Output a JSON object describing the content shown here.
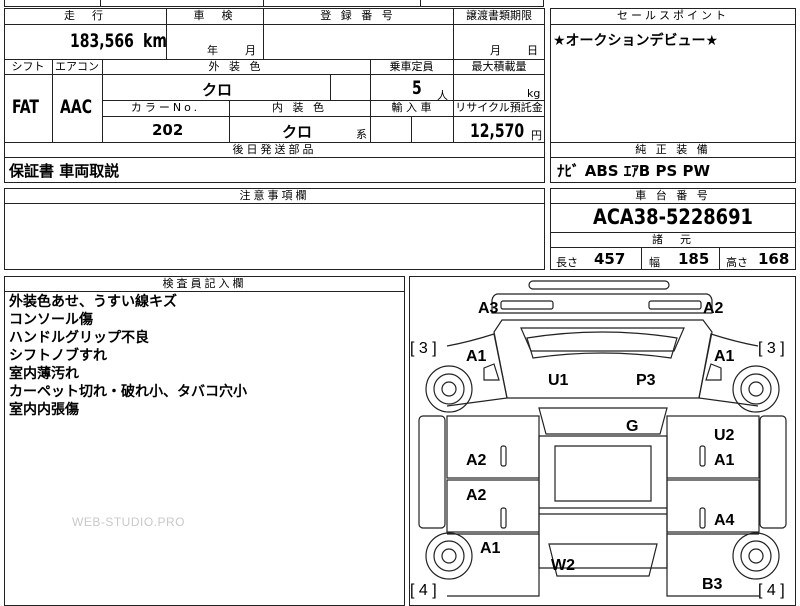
{
  "top_row": {
    "cells": [
      "",
      "",
      "",
      ""
    ]
  },
  "mileage": {
    "header": "走　行",
    "value": "183,566",
    "unit": "km"
  },
  "inspection": {
    "header": "車　検",
    "year_unit": "年",
    "month_unit": "月"
  },
  "registration": {
    "header": "登 録 番 号",
    "value": ""
  },
  "transfer": {
    "header": "譲渡書類期限",
    "month_unit": "月",
    "day_unit": "日"
  },
  "sales_point": {
    "header": "セールスポイント",
    "text": "★オークションデビュー★"
  },
  "shift": {
    "header": "シフト",
    "value": "FAT"
  },
  "aircon": {
    "header": "エアコン",
    "value": "AAC"
  },
  "exterior_color": {
    "header": "外 装 色",
    "value": "クロ"
  },
  "capacity": {
    "header": "乗車定員",
    "value": "5",
    "unit": "人"
  },
  "max_load": {
    "header": "最大積載量",
    "unit": "kg"
  },
  "color_no": {
    "header": "カラーNo.",
    "value": "202"
  },
  "interior_color": {
    "header": "内 装 色",
    "value": "クロ",
    "unit": "系"
  },
  "import": {
    "header": "輸 入 車"
  },
  "recycle": {
    "header": "リサイクル預託金",
    "value": "12,570",
    "unit": "円"
  },
  "later_parts": {
    "header": "後日発送部品",
    "value": "保証書 車両取説"
  },
  "genuine_equipment": {
    "header": "純 正 装 備",
    "value": "ﾅﾋﾞ ABS ｴｱB PS PW"
  },
  "caution": {
    "header": "注意事項欄",
    "value": ""
  },
  "chassis": {
    "header": "車 台 番 号",
    "value": "ACA38-5228691"
  },
  "specs": {
    "header": "諸　元",
    "length_label": "長さ",
    "length": "457",
    "width_label": "幅",
    "width": "185",
    "height_label": "高さ",
    "height": "168"
  },
  "inspector": {
    "header": "検査員記入欄",
    "notes": [
      "外装色あせ、うすい線キズ",
      "コンソール傷",
      "ハンドルグリップ不良",
      "シフトノブすれ",
      "室内薄汚れ",
      "カーペット切れ・破れ小、タバコ穴小",
      "室内内張傷"
    ]
  },
  "watermark": "WEB-STUDIO.PRO",
  "diagram": {
    "labels": {
      "a3": "A3",
      "a2_front_right": "A2",
      "bracket_left_top": "[ 3 ]",
      "bracket_right_top": "[ 3 ]",
      "a1_left_fender": "A1",
      "a1_right_fender": "A1",
      "u1": "U1",
      "p3": "P3",
      "g": "G",
      "u2": "U2",
      "a2_left_front_door": "A2",
      "a1_right_front_door": "A1",
      "a2_left_rear_door": "A2",
      "a4": "A4",
      "a1_left_quarter": "A1",
      "w2": "W2",
      "b3": "B3",
      "bracket_left_bottom": "[ 4 ]",
      "bracket_right_bottom": "[ 4 ]"
    }
  }
}
